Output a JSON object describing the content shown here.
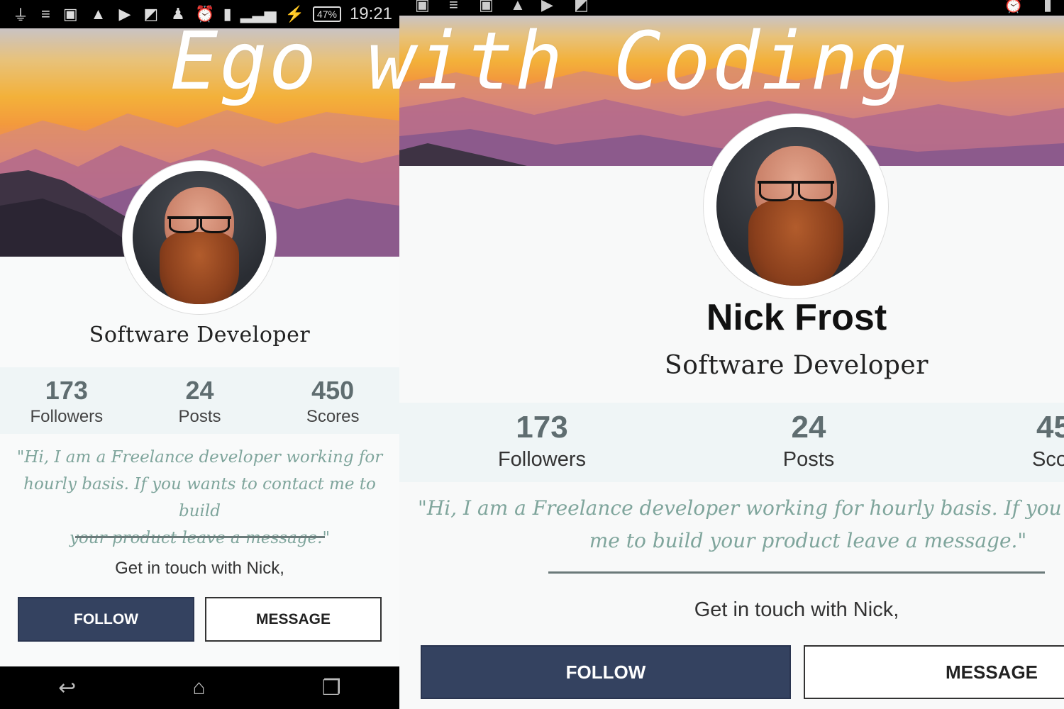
{
  "watermark": "Ego with Coding",
  "status_bar": {
    "battery": "47%",
    "time": "19:21"
  },
  "profile": {
    "name": "Nick Frost",
    "title": "Software Developer",
    "stats": [
      {
        "value": "173",
        "label": "Followers"
      },
      {
        "value": "24",
        "label": "Posts"
      },
      {
        "value": "450",
        "label": "Scores"
      }
    ],
    "quote_left": [
      "\"Hi, I am a Freelance developer working for",
      "hourly basis. If you wants to contact me to build",
      "your product leave a message.\""
    ],
    "quote_right": [
      "\"Hi, I am a Freelance developer working for hourly basis. If you wants to contact",
      "me to build your product leave a message.\""
    ],
    "contact_prompt": "Get in touch with Nick,",
    "follow_label": "FOLLOW",
    "message_label": "MESSAGE"
  },
  "icons": {
    "usb": "usb-icon",
    "nav_back": "back-icon",
    "nav_home": "home-icon",
    "nav_recents": "recents-icon"
  },
  "colors": {
    "follow_button": "#344260",
    "quote_text": "#7fa59c",
    "stats_band": "#eff5f6"
  }
}
